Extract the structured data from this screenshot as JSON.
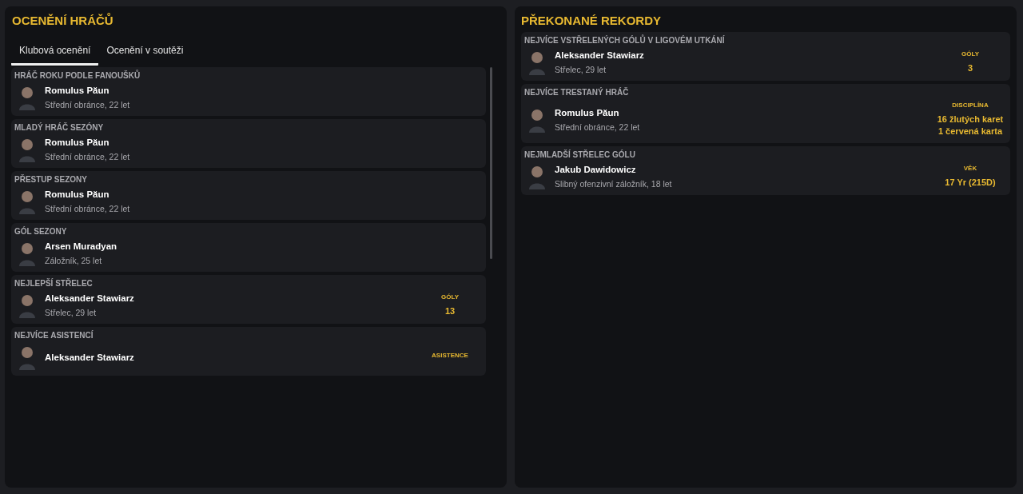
{
  "awards_panel": {
    "title": "OCENĚNÍ HRÁČŮ",
    "tabs": [
      {
        "label": "Klubová ocenění",
        "selected": true
      },
      {
        "label": "Ocenění v soutěži",
        "selected": false
      }
    ],
    "awards": [
      {
        "category": "HRÁČ ROKU PODLE FANOUŠKŮ",
        "player": "Romulus Păun",
        "details": "Střední obránce, 22 let"
      },
      {
        "category": "MLADÝ HRÁČ SEZÓNY",
        "player": "Romulus Păun",
        "details": "Střední obránce, 22 let"
      },
      {
        "category": "PŘESTUP SEZONY",
        "player": "Romulus Păun",
        "details": "Střední obránce, 22 let"
      },
      {
        "category": "GÓL SEZONY",
        "player": "Arsen Muradyan",
        "details": "Záložník, 25 let"
      },
      {
        "category": "NEJLEPŠÍ STŘELEC",
        "player": "Aleksander Stawiarz",
        "details": "Střelec, 29 let",
        "stat_label": "GÓLY",
        "stat_value": [
          "13"
        ]
      },
      {
        "category": "NEJVÍCE ASISTENCÍ",
        "player": "Aleksander Stawiarz",
        "stat_label": "ASISTENCE"
      }
    ]
  },
  "records_panel": {
    "title": "PŘEKONANÉ REKORDY",
    "records": [
      {
        "category": "NEJVÍCE VSTŘELENÝCH GÓLŮ V LIGOVÉM UTKÁNÍ",
        "player": "Aleksander Stawiarz",
        "details": "Střelec, 29 let",
        "stat_label": "GÓLY",
        "stat_value": [
          "3"
        ]
      },
      {
        "category": "NEJVÍCE TRESTANÝ HRÁČ",
        "player": "Romulus Păun",
        "details": "Střední obránce, 22 let",
        "stat_label": "DISCIPLÍNA",
        "stat_value": [
          "16 žlutých karet",
          "1 červená karta"
        ]
      },
      {
        "category": "NEJMLADŠÍ STŘELEC GÓLU",
        "player": "Jakub Dawidowicz",
        "details": "Slibný ofenzivní záložník, 18 let",
        "stat_label": "VĚK",
        "stat_value": [
          "17 Yr (215D)"
        ]
      }
    ]
  }
}
